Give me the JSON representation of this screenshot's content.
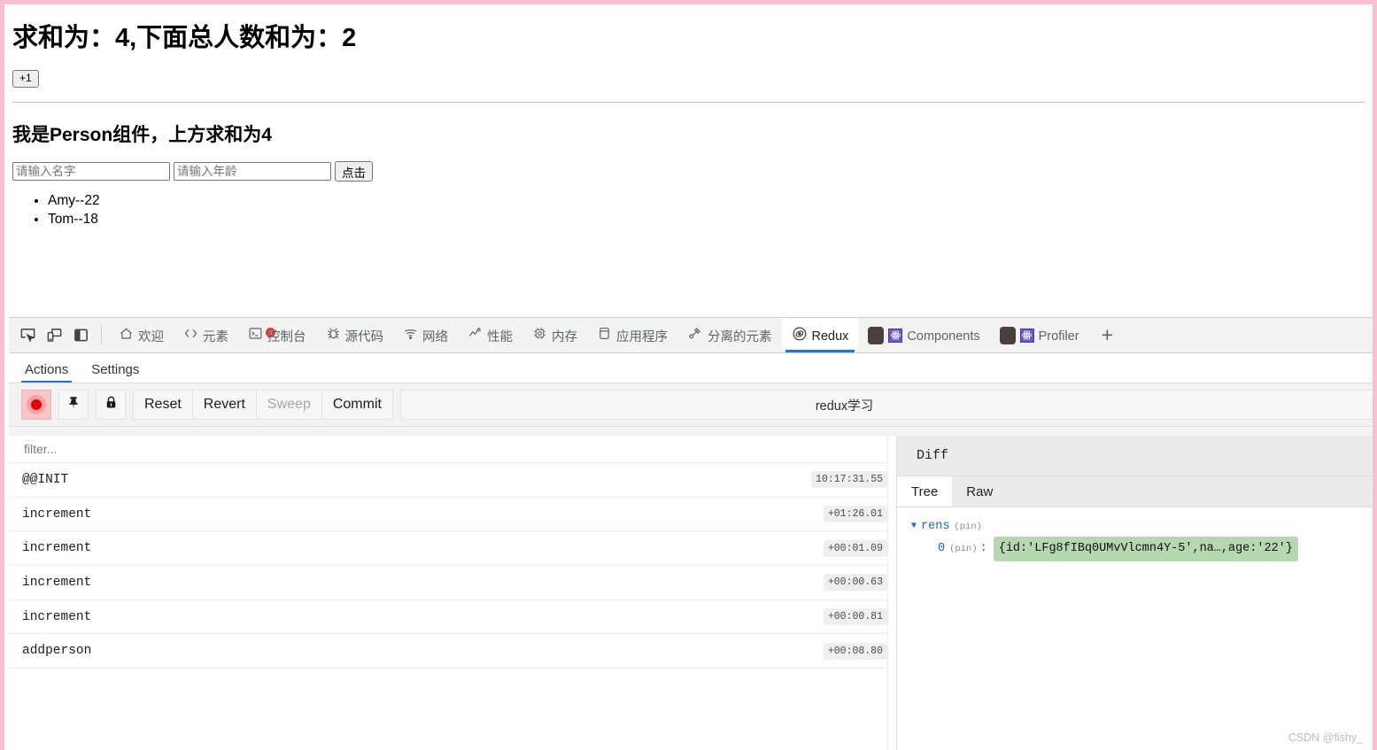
{
  "app": {
    "sum_heading": "求和为：4,下面总人数和为：2",
    "increment_button": "+1",
    "person_heading": "我是Person组件，上方求和为4",
    "name_placeholder": "请输入名字",
    "name_value": "",
    "age_placeholder": "请输入年龄",
    "age_value": "",
    "submit_button": "点击",
    "people": [
      "Amy--22",
      "Tom--18"
    ]
  },
  "devtools": {
    "left_icons": [
      {
        "name": "inspect-element-icon"
      },
      {
        "name": "device-toolbar-icon"
      },
      {
        "name": "dock-panel-icon"
      }
    ],
    "tabs": [
      {
        "label": "欢迎",
        "icon": "home-icon",
        "active": false
      },
      {
        "label": "元素",
        "icon": "code-brackets-icon",
        "active": false
      },
      {
        "label": "控制台",
        "icon": "console-icon",
        "active": false,
        "error_badge": "x"
      },
      {
        "label": "源代码",
        "icon": "bug-icon",
        "active": false
      },
      {
        "label": "网络",
        "icon": "wifi-icon",
        "active": false
      },
      {
        "label": "性能",
        "icon": "performance-icon",
        "active": false
      },
      {
        "label": "内存",
        "icon": "memory-chip-icon",
        "active": false
      },
      {
        "label": "应用程序",
        "icon": "application-icon",
        "active": false
      },
      {
        "label": "分离的元素",
        "icon": "detached-elements-icon",
        "active": false
      },
      {
        "label": "Redux",
        "icon": "redux-icon",
        "active": true
      },
      {
        "label": "Components",
        "icon": "react-components-icon",
        "active": false
      },
      {
        "label": "Profiler",
        "icon": "react-profiler-icon",
        "active": false
      }
    ],
    "add_tab_label": "+"
  },
  "redux": {
    "subtabs": [
      {
        "label": "Actions",
        "active": true
      },
      {
        "label": "Settings",
        "active": false
      }
    ],
    "toolbar": {
      "record_icon": "record-icon",
      "pin_icon": "pin-icon",
      "lock_icon": "lock-icon",
      "reset_label": "Reset",
      "revert_label": "Revert",
      "sweep_label": "Sweep",
      "commit_label": "Commit",
      "instance_title": "redux学习"
    },
    "filter_placeholder": "filter...",
    "filter_value": "",
    "actions": [
      {
        "name": "@@INIT",
        "time": "10:17:31.55"
      },
      {
        "name": "increment",
        "time": "+01:26.01"
      },
      {
        "name": "increment",
        "time": "+00:01.09"
      },
      {
        "name": "increment",
        "time": "+00:00.63"
      },
      {
        "name": "increment",
        "time": "+00:00.81"
      },
      {
        "name": "addperson",
        "time": "+00:08.80"
      }
    ],
    "diff": {
      "title": "Diff",
      "tabs": [
        {
          "label": "Tree",
          "active": true
        },
        {
          "label": "Raw",
          "active": false
        }
      ],
      "tree": {
        "root_key": "rens",
        "root_pin": "(pin)",
        "child_key": "0",
        "child_pin": "(pin)",
        "child_sep": ":",
        "child_value": "{id:'LFg8fIBq0UMvVlcmn4Y-5',na…,age:'22'}"
      }
    }
  },
  "watermark": "CSDN @fishy_",
  "colors": {
    "accent_blue": "#1a73e8",
    "highlight_pink": "#f7bfd0",
    "diff_added": "#b6d7b0",
    "record_red": "#e60000"
  }
}
